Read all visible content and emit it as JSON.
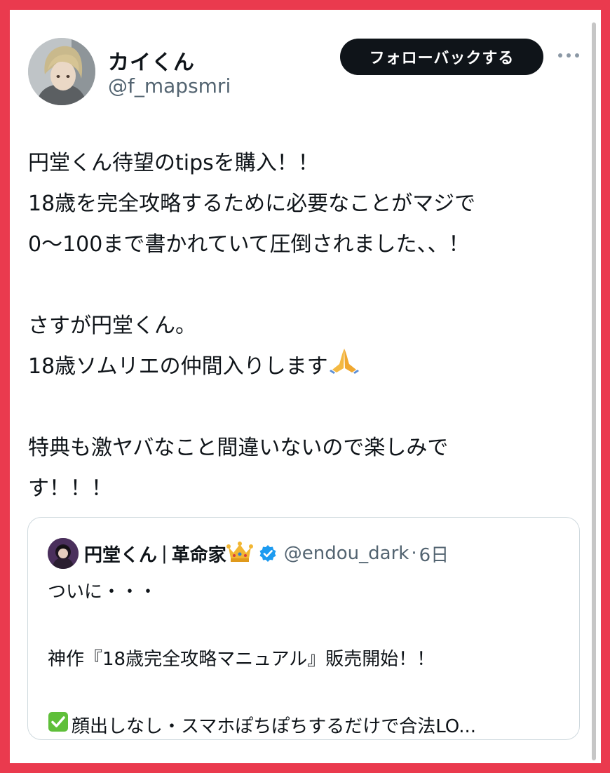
{
  "author": {
    "display_name": "カイくん",
    "handle": "@f_mapsmri"
  },
  "follow_button": {
    "label": "フォローバックする"
  },
  "more_icon": "more-horizontal-icon",
  "tweet": {
    "lines": [
      "円堂くん待望のtipsを購入！！",
      "18歳を完全攻略するために必要なことがマジで",
      "0〜100まで書かれていて圧倒されました、、！",
      "",
      "さすが円堂くん。",
      "18歳ソムリエの仲間入りします",
      "",
      "特典も激ヤバなこと間違いないので楽しみで",
      "す！！！"
    ],
    "emoji": "folded-hands-icon"
  },
  "quote": {
    "display_name": "円堂くん",
    "separator": "|",
    "title": "革命家",
    "crown_icon": "crown-icon",
    "verified_icon": "verified-badge-icon",
    "handle": "@endou_dark",
    "dot": "·",
    "time": "6日",
    "lines": [
      "ついに・・・",
      "",
      "神作『18歳完全攻略マニュアル』販売開始！！",
      "",
      "顔出しなし・スマホぽちぽちするだけで合法LO..."
    ],
    "check_icon": "check-mark-button-icon"
  },
  "colors": {
    "frame": "#ea3a4e",
    "text": "#0f1419",
    "muted": "#536471",
    "verified": "#1d9bf0",
    "check": "#5fbf3a"
  }
}
